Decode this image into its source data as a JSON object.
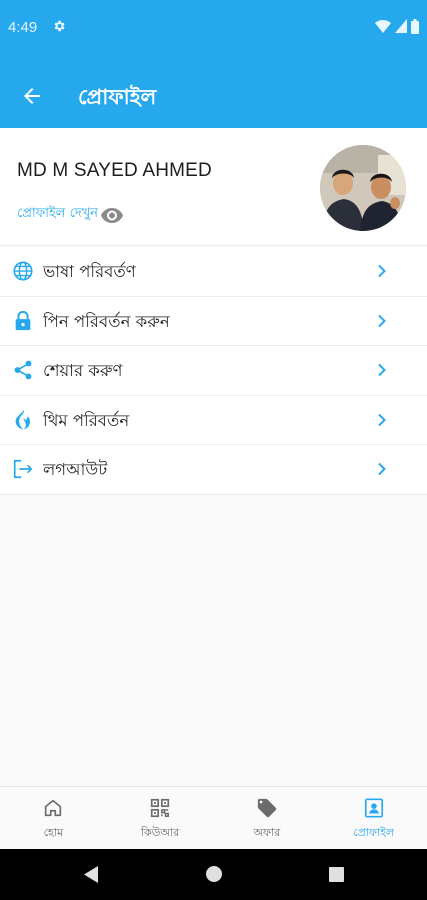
{
  "status_bar": {
    "time": "4:49",
    "settings_icon": "gear-icon",
    "wifi_icon": "wifi-icon",
    "signal_icon": "signal-icon",
    "battery_icon": "battery-icon"
  },
  "app_bar": {
    "back_icon": "arrow-back-icon",
    "title": "প্রোফাইল"
  },
  "profile": {
    "name": "MD M SAYED AHMED",
    "view_link": "প্রোফাইল দেখুন",
    "view_icon": "eye-icon"
  },
  "menu": {
    "items": [
      {
        "label": "ভাষা পরিবর্তণ",
        "icon": "globe-icon"
      },
      {
        "label": "পিন পরিবর্তন করুন",
        "icon": "lock-icon"
      },
      {
        "label": "শেয়ার করুণ",
        "icon": "share-icon"
      },
      {
        "label": "থিম পরিবর্তন",
        "icon": "flame-icon"
      },
      {
        "label": "লগআউট",
        "icon": "logout-icon"
      }
    ]
  },
  "bottom_nav": {
    "items": [
      {
        "label": "হোম",
        "icon": "home-icon",
        "active": false
      },
      {
        "label": "কিউআর",
        "icon": "qr-icon",
        "active": false
      },
      {
        "label": "অফার",
        "icon": "tag-icon",
        "active": false
      },
      {
        "label": "প্রোফাইল",
        "icon": "profile-badge-icon",
        "active": true
      }
    ]
  },
  "colors": {
    "primary": "#26a9ec",
    "text": "#212121",
    "inactive": "#666666"
  }
}
